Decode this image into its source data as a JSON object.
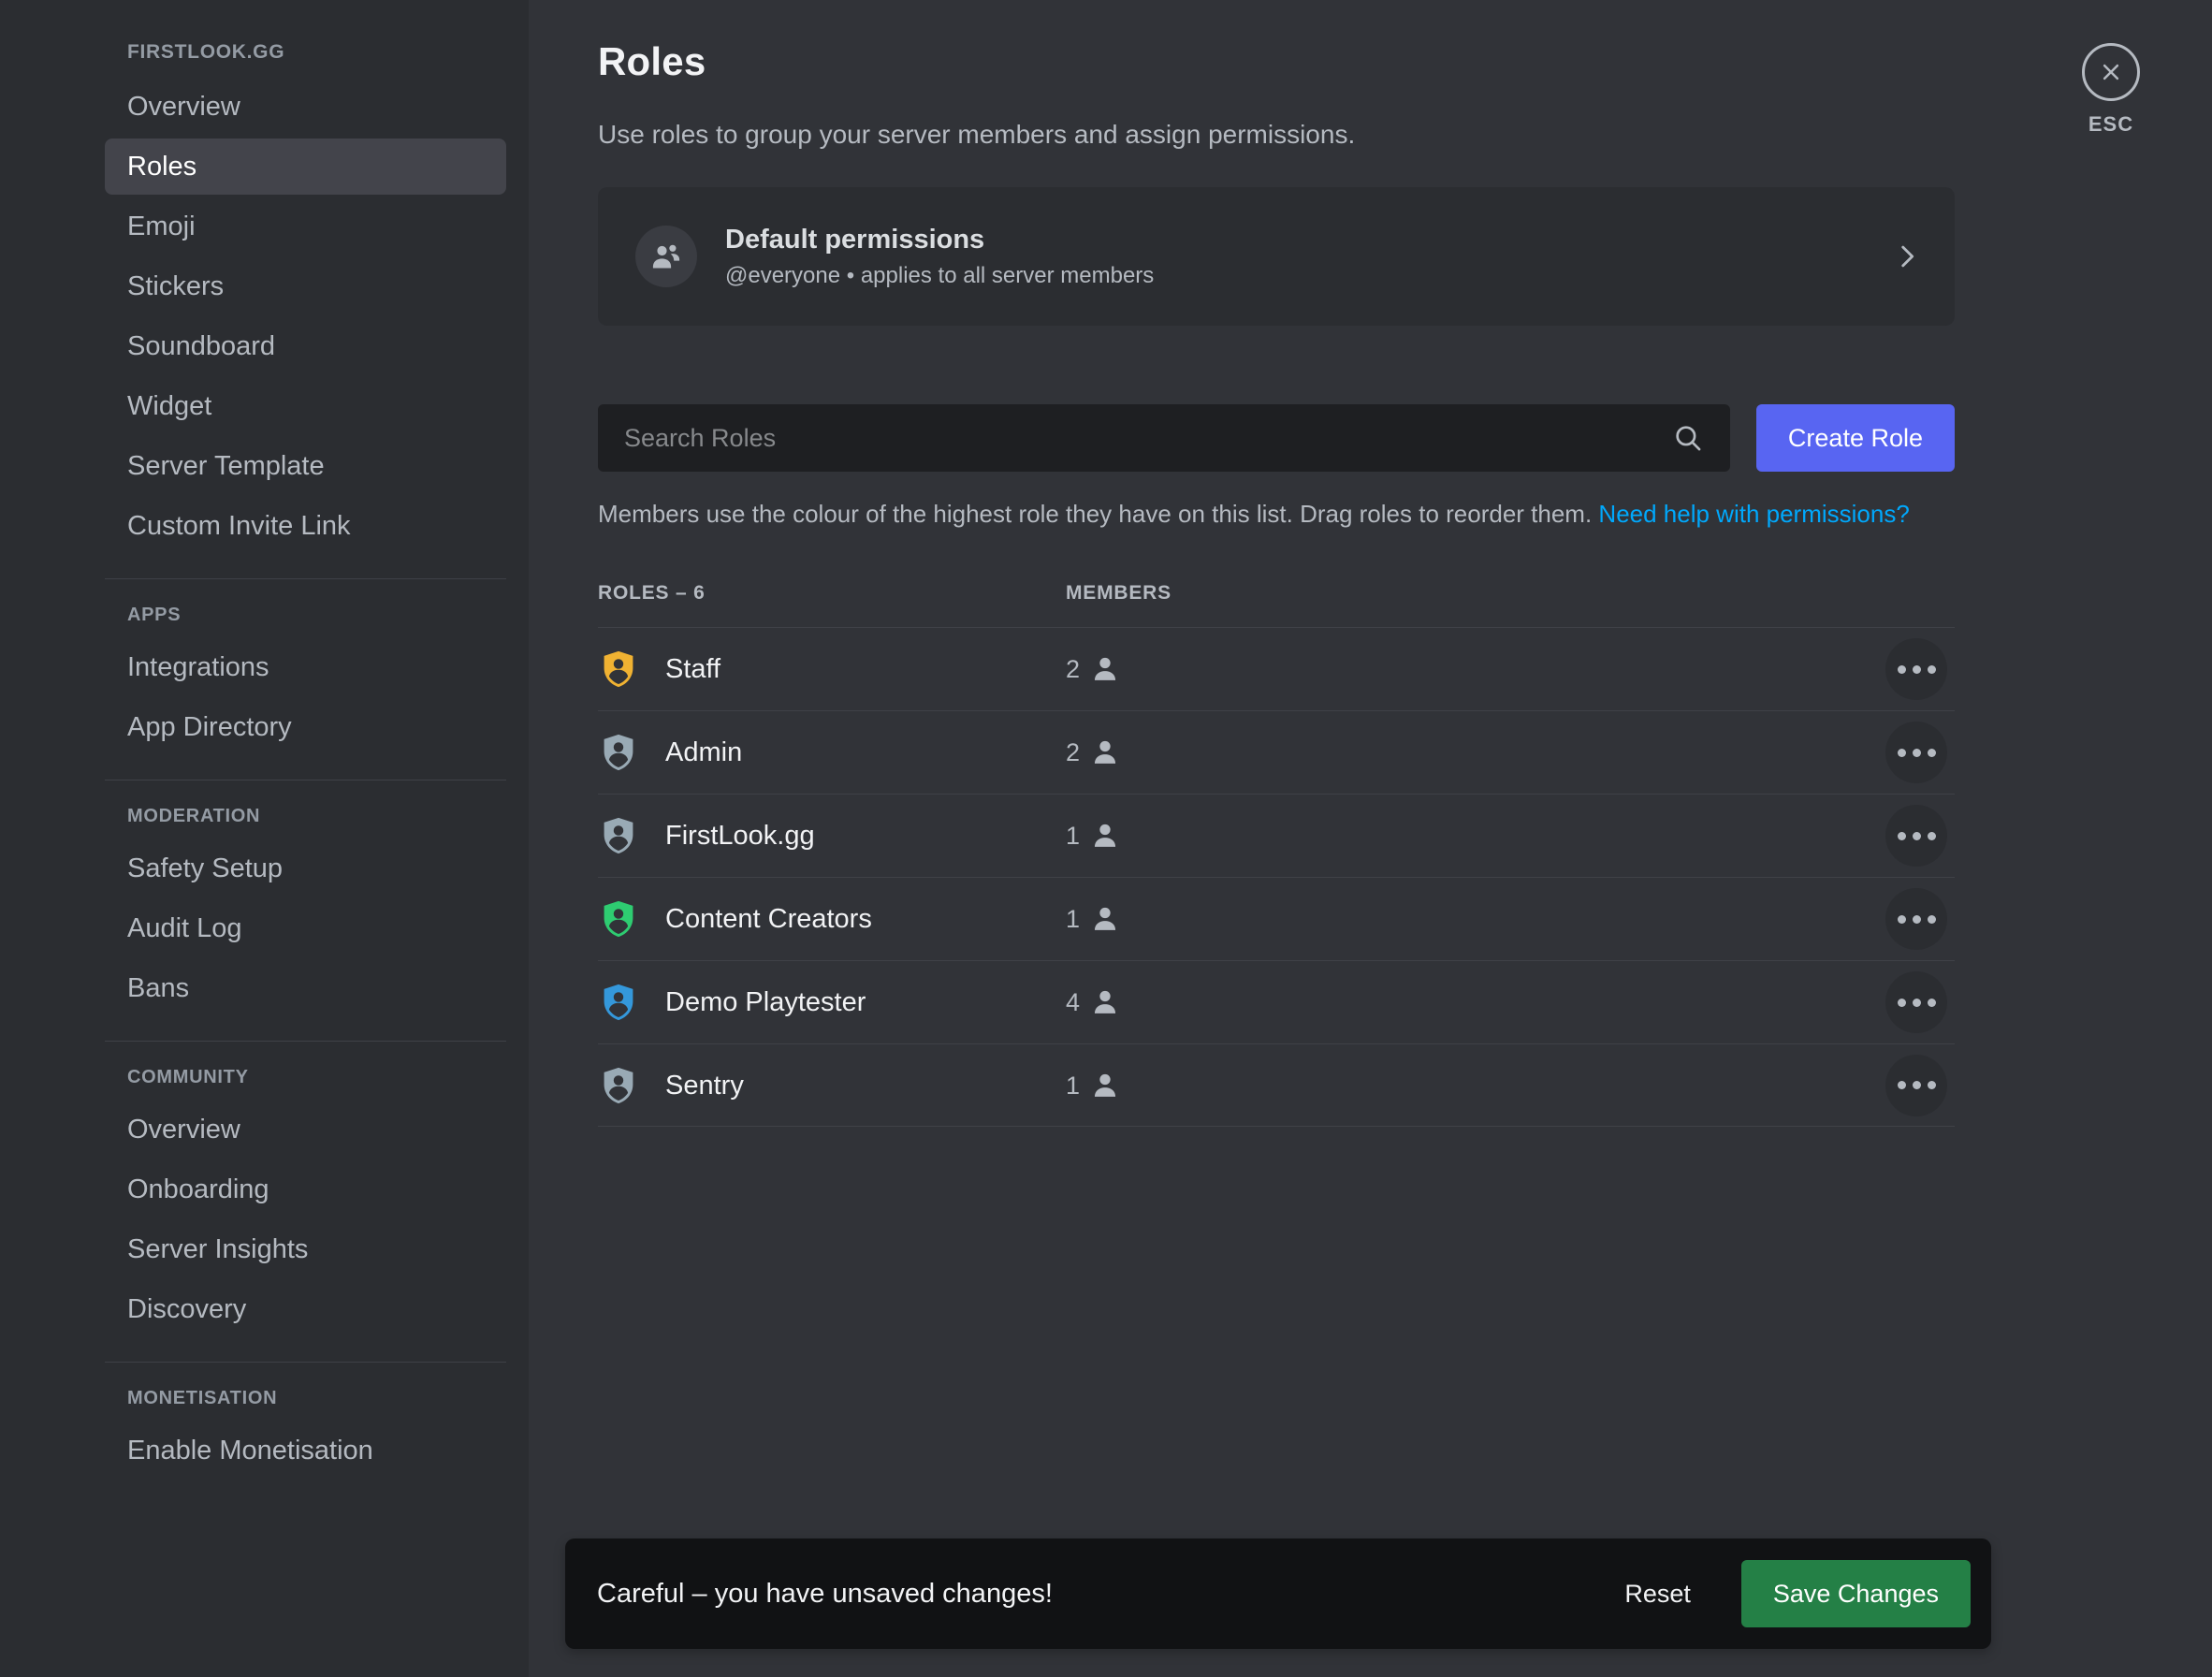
{
  "sidebar": {
    "server_name": "FIRSTLOOK.GG",
    "server_items": [
      {
        "label": "Overview",
        "active": false
      },
      {
        "label": "Roles",
        "active": true
      },
      {
        "label": "Emoji",
        "active": false
      },
      {
        "label": "Stickers",
        "active": false
      },
      {
        "label": "Soundboard",
        "active": false
      },
      {
        "label": "Widget",
        "active": false
      },
      {
        "label": "Server Template",
        "active": false
      },
      {
        "label": "Custom Invite Link",
        "active": false
      }
    ],
    "section_apps_label": "APPS",
    "apps_items": [
      {
        "label": "Integrations"
      },
      {
        "label": "App Directory"
      }
    ],
    "section_moderation_label": "MODERATION",
    "moderation_items": [
      {
        "label": "Safety Setup"
      },
      {
        "label": "Audit Log"
      },
      {
        "label": "Bans"
      }
    ],
    "section_community_label": "COMMUNITY",
    "community_items": [
      {
        "label": "Overview"
      },
      {
        "label": "Onboarding"
      },
      {
        "label": "Server Insights"
      },
      {
        "label": "Discovery"
      }
    ],
    "section_monetisation_label": "MONETISATION",
    "monetisation_items": [
      {
        "label": "Enable Monetisation"
      }
    ]
  },
  "close": {
    "label": "ESC",
    "icon": "close-icon"
  },
  "page": {
    "title": "Roles",
    "subtitle": "Use roles to group your server members and assign permissions."
  },
  "default_permissions": {
    "icon": "people-icon",
    "title": "Default permissions",
    "subtitle": "@everyone • applies to all server members",
    "chevron": "chevron-right-icon"
  },
  "search": {
    "placeholder": "Search Roles",
    "value": "",
    "icon": "search-icon"
  },
  "create_role": {
    "label": "Create Role",
    "color": "#5865f2"
  },
  "hint": {
    "text": "Members use the colour of the highest role they have on this list. Drag roles to reorder them. ",
    "link_text": "Need help with permissions?",
    "link_color": "#00a8fc"
  },
  "roles_table": {
    "header_roles": "ROLES – 6",
    "header_members": "MEMBERS",
    "rows": [
      {
        "name": "Staff",
        "color": "#f0b232",
        "members": "2",
        "menu_icon": "more-options-icon"
      },
      {
        "name": "Admin",
        "color": "#99aab5",
        "members": "2",
        "menu_icon": "more-options-icon"
      },
      {
        "name": "FirstLook.gg",
        "color": "#99aab5",
        "members": "1",
        "menu_icon": "more-options-icon"
      },
      {
        "name": "Content Creators",
        "color": "#2ecc71",
        "members": "1",
        "menu_icon": "more-options-icon"
      },
      {
        "name": "Demo Playtester",
        "color": "#3498db",
        "members": "4",
        "menu_icon": "more-options-icon"
      },
      {
        "name": "Sentry",
        "color": "#99aab5",
        "members": "1",
        "menu_icon": "more-options-icon"
      }
    ]
  },
  "unsaved_bar": {
    "message": "Careful – you have unsaved changes!",
    "reset_label": "Reset",
    "save_label": "Save Changes",
    "save_color": "#248046"
  }
}
